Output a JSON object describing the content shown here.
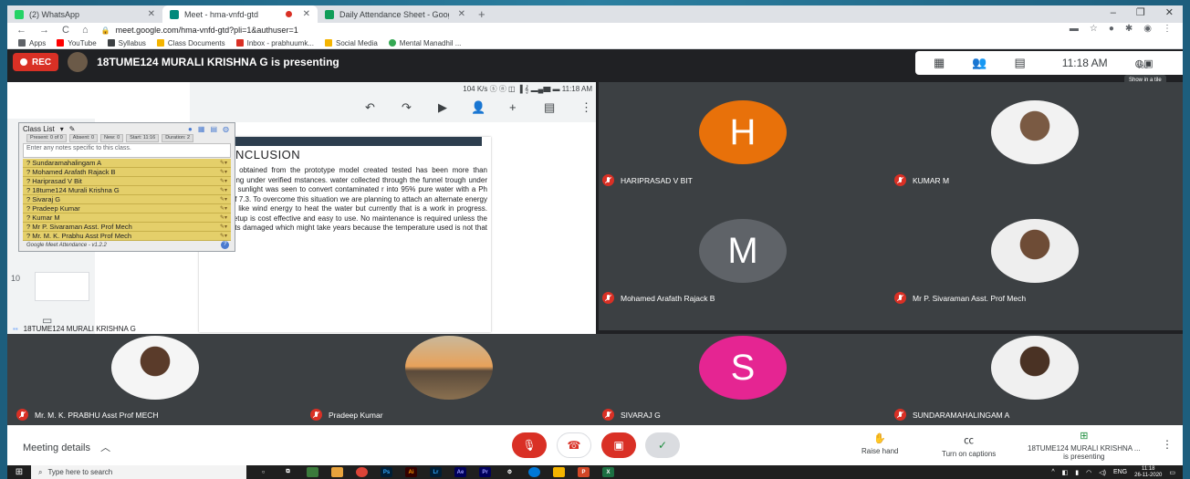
{
  "browser": {
    "tabs": [
      {
        "title": "(2) WhatsApp",
        "color": "#25d366"
      },
      {
        "title": "Meet - hma-vnfd-gtd",
        "color": "#00897b"
      },
      {
        "title": "Daily Attendance Sheet - Google",
        "color": "#0f9d58"
      }
    ],
    "url": "meet.google.com/hma-vnfd-gtd?pli=1&authuser=1",
    "bookmarks": [
      "Apps",
      "YouTube",
      "Syllabus",
      "Class Documents",
      "Inbox - prabhuumk...",
      "Social Media",
      "Mental Manadhil ..."
    ],
    "window_controls": [
      "–",
      "❐",
      "✕"
    ]
  },
  "meet": {
    "rec_label": "REC",
    "presenting_text": "18TUME124 MURALI KRISHNA G is presenting",
    "clock": "11:18 AM",
    "you_label": "You",
    "tooltip": "Show in a tile",
    "presentation_label": "18TUME124 MURALI KRISHNA G",
    "phone_status": "104 K/s ⓢ ⓝ ◫ ▐ 𝄞 ▂▄▆ ▬ 11:18 AM",
    "thumb_number": "10",
    "slide_heading": "NCLUSION",
    "slide_body": "results obtained from the prototype model created tested has been more than satisfying under verified mstances. water collected through the funnel trough under inuous sunlight was seen to convert contaminated r into 95% pure water with a Ph level of 7.3. To overcome this situation we are planning to attach an alternate energy source like wind energy to heat the water but currently that is a work in progress. This setup is cost effective and easy to use. No maintenance is required unless the coil gets damaged which might take years because the temperature used is not that high."
  },
  "class_list": {
    "title": "Class List",
    "stats": [
      "Present: 0 of 0",
      "Absent: 0",
      "New: 0",
      "Start: 11:16",
      "Duration: 2"
    ],
    "notes_placeholder": "Enter any notes specific to this class.",
    "names": [
      "? Sundaramahalingam A",
      "? Mohamed Arafath Rajack B",
      "? Hariprasad V Bit",
      "? 18tume124 Murali Krishna G",
      "? Sivaraj G",
      "? Pradeep Kumar",
      "? Kumar M",
      "? Mr P. Sivaraman Asst. Prof Mech",
      "? Mr. M. K. Prabhu Asst Prof Mech"
    ],
    "footer": "Google Meet Attendance - v1.2.2",
    "help": "?"
  },
  "participants": [
    {
      "name": "HARIPRASAD V BIT",
      "initial": "H",
      "color": "#e8710a"
    },
    {
      "name": "KUMAR M",
      "photo": true
    },
    {
      "name": "Mohamed Arafath Rajack B",
      "initial": "M",
      "color": "#5f6368"
    },
    {
      "name": "Mr P. Sivaraman Asst. Prof Mech",
      "photo": true
    },
    {
      "name": "Mr. M. K. PRABHU Asst Prof MECH",
      "photo": true
    },
    {
      "name": "Pradeep Kumar",
      "photo": true
    },
    {
      "name": "SIVARAJ G",
      "initial": "S",
      "color": "#e52592"
    },
    {
      "name": "SUNDARAMAHALINGAM A",
      "photo": true
    }
  ],
  "bottom": {
    "meeting_details": "Meeting details",
    "raise_hand": "Raise hand",
    "captions": "Turn on captions",
    "presenting_name": "18TUME124 MURALI KRISHNA ...",
    "presenting_sub": "is presenting"
  },
  "taskbar": {
    "search_placeholder": "Type here to search",
    "lang": "ENG",
    "time": "11:18",
    "date": "26-11-2020"
  }
}
